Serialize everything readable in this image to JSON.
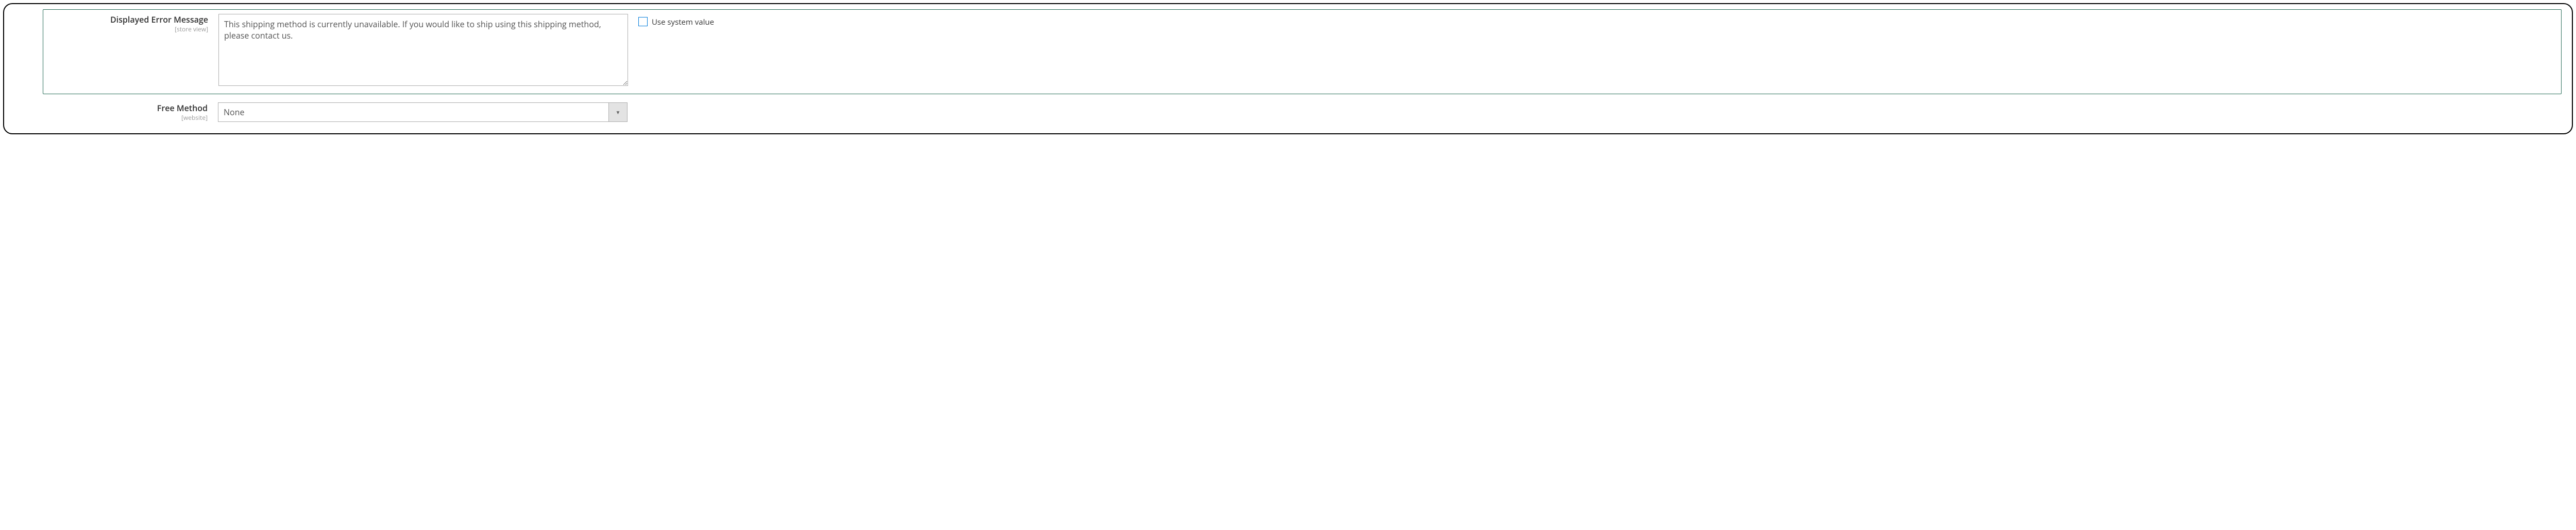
{
  "fields": {
    "error_message": {
      "label": "Displayed Error Message",
      "scope": "[store view]",
      "value": "This shipping method is currently unavailable. If you would like to ship using this shipping method, please contact us.",
      "use_system_label": "Use system value"
    },
    "free_method": {
      "label": "Free Method",
      "scope": "[website]",
      "value": "None"
    }
  }
}
